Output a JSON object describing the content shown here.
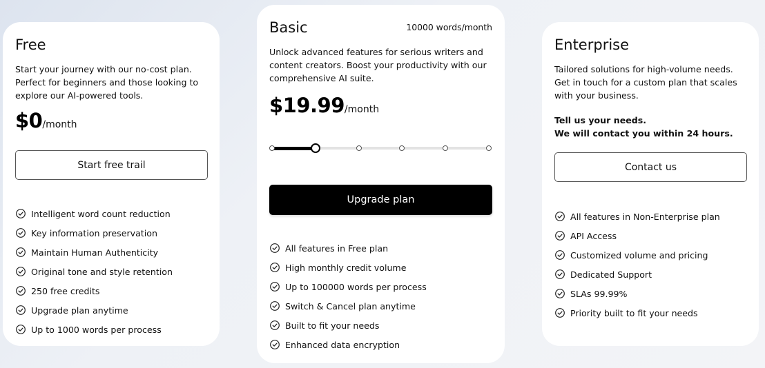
{
  "plans": {
    "free": {
      "name": "Free",
      "description": "Start your journey with our no-cost plan. Perfect for beginners and those looking to explore our AI-powered tools.",
      "price": "$0",
      "per": "/month",
      "button_label": "Start free trail",
      "features": [
        "Intelligent word count reduction",
        "Key information preservation",
        "Maintain Human Authenticity",
        "Original tone and style retention",
        "250 free credits",
        "Upgrade plan anytime",
        "Up to 1000 words per process"
      ]
    },
    "basic": {
      "name": "Basic",
      "words_per_month": "10000 words/month",
      "description": "Unlock advanced features for serious writers and content creators. Boost your productivity with our comprehensive AI suite.",
      "price": "$19.99",
      "per": "/month",
      "slider": {
        "steps": 6,
        "selected_index": 1
      },
      "button_label": "Upgrade plan",
      "features": [
        "All features in Free plan",
        "High monthly credit volume",
        "Up to 100000 words per process",
        "Switch & Cancel plan anytime",
        "Built to fit your needs",
        "Enhanced data encryption"
      ]
    },
    "enterprise": {
      "name": "Enterprise",
      "description": "Tailored solutions for high-volume needs. Get in touch for a custom plan that scales with your business.",
      "note_line1": "Tell us your needs.",
      "note_line2": "We will contact you within 24 hours.",
      "button_label": "Contact us",
      "features": [
        "All features in Non-Enterprise plan",
        "API Access",
        "Customized volume and pricing",
        "Dedicated Support",
        "SLAs 99.99%",
        "Priority built to fit your needs"
      ]
    }
  },
  "icons": {
    "feature": "check-circle-icon"
  },
  "colors": {
    "accent": "#000000",
    "card": "#ffffff",
    "track": "#e3e3e3"
  }
}
